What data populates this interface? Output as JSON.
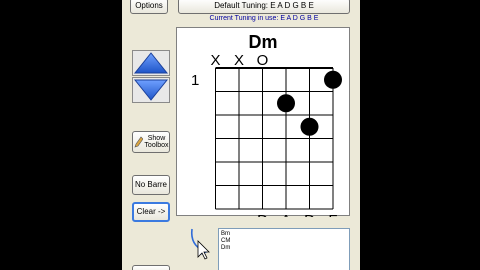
{
  "toolbar": {
    "options_label": "Options",
    "tuning_label": "Default Tuning: E A D G B E"
  },
  "current_tuning": "Current Tuning in use: E A D G B E",
  "buttons": {
    "up_icon": "up-arrow-icon",
    "down_icon": "down-arrow-icon",
    "show_toolbox_line1": "Show",
    "show_toolbox_line2": "Toolbox",
    "no_barre": "No Barre",
    "clear": "Clear ->"
  },
  "chord": {
    "name": "Dm",
    "fret_number": "1",
    "open_muted": [
      "X",
      "X",
      "O",
      "",
      "",
      ""
    ],
    "bottom_notes": [
      "",
      "",
      "D",
      "A",
      "D",
      "F"
    ],
    "dots": [
      {
        "string": 6,
        "fret": 1
      },
      {
        "string": 4,
        "fret": 2
      },
      {
        "string": 5,
        "fret": 3
      }
    ]
  },
  "list": {
    "items": [
      "Bm",
      "CM",
      "Dm"
    ]
  },
  "colors": {
    "accent": "#2f6bd8",
    "dot": "#000000"
  }
}
